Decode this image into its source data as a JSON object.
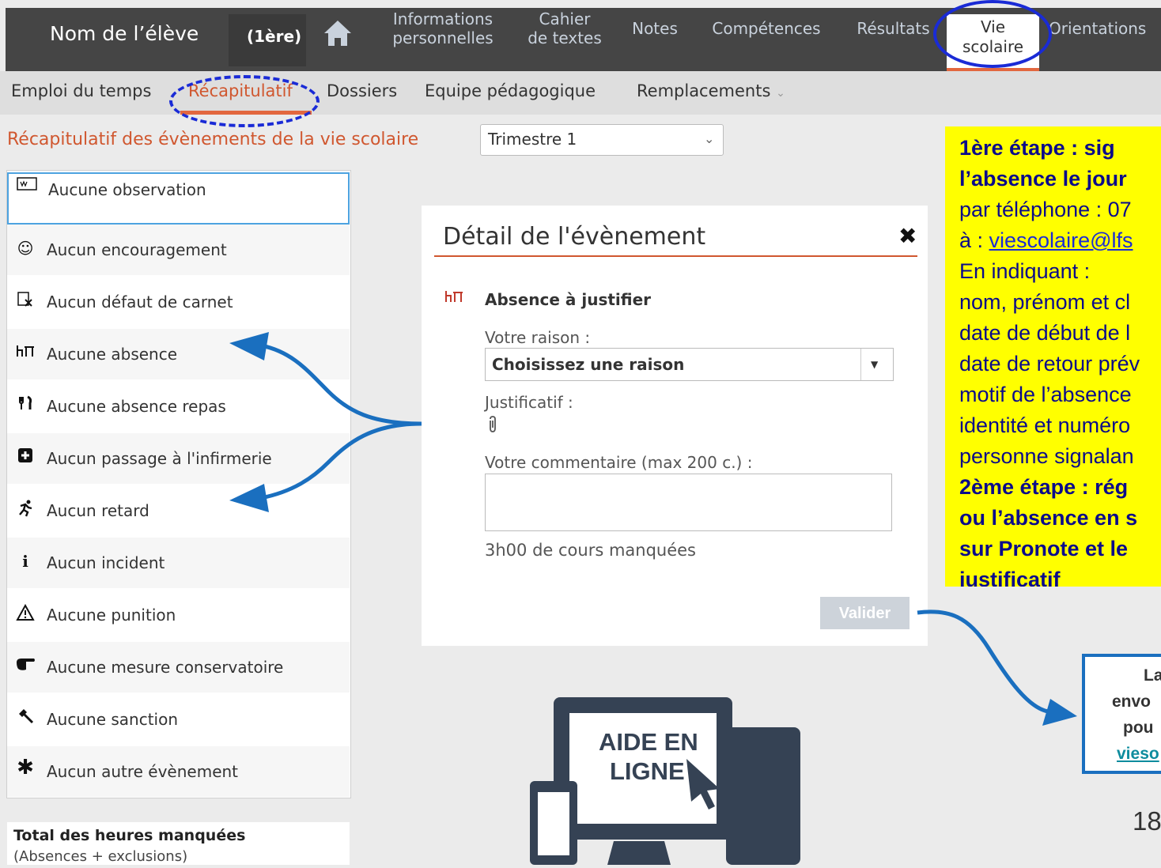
{
  "header": {
    "student_name": "Nom de l’élève",
    "class_label": "(1ère)",
    "tabs": [
      {
        "label_1": "Informations",
        "label_2": "personnelles"
      },
      {
        "label_1": "Cahier",
        "label_2": "de textes"
      },
      {
        "label": "Notes"
      },
      {
        "label": "Compétences"
      },
      {
        "label": "Résultats"
      },
      {
        "label_1": "Vie",
        "label_2": "scolaire",
        "active": true
      },
      {
        "label": "Orientations"
      }
    ]
  },
  "subnav": {
    "items": [
      "Emploi du temps",
      "Récapitulatif",
      "Dossiers",
      "Equipe pédagogique",
      "Remplacements"
    ]
  },
  "page": {
    "title": "Récapitulatif des évènements de la vie scolaire",
    "period": "Trimestre 1"
  },
  "events": [
    {
      "icon": "observation-icon",
      "label": "Aucune observation"
    },
    {
      "icon": "smiley-icon",
      "label": "Aucun encouragement"
    },
    {
      "icon": "notebook-defect-icon",
      "label": "Aucun défaut de carnet"
    },
    {
      "icon": "desk-icon",
      "label": "Aucune absence"
    },
    {
      "icon": "cutlery-icon",
      "label": "Aucune absence repas"
    },
    {
      "icon": "medical-cross-icon",
      "label": "Aucun passage à l'infirmerie"
    },
    {
      "icon": "running-icon",
      "label": "Aucun retard"
    },
    {
      "icon": "info-icon",
      "label": "Aucun incident"
    },
    {
      "icon": "warning-icon",
      "label": "Aucune punition"
    },
    {
      "icon": "pointing-hand-icon",
      "label": "Aucune mesure conservatoire"
    },
    {
      "icon": "gavel-icon",
      "label": "Aucune sanction"
    },
    {
      "icon": "asterisk-icon",
      "label": "Aucun autre évènement"
    }
  ],
  "totals": {
    "label": "Total des heures manquées",
    "sub": "(Absences + exclusions)"
  },
  "modal": {
    "title": "Détail de l'évènement",
    "type": "Absence à justifier",
    "reason_label": "Votre raison :",
    "reason_placeholder": "Choisissez une raison",
    "proof_label": "Justificatif :",
    "comment_label": "Votre commentaire (max 200 c.) :",
    "hours_missed": "3h00 de cours manquées",
    "validate": "Valider"
  },
  "note": {
    "step1_a": "1ère étape : sig",
    "step1_b": "l’absence le jour",
    "phone": "par téléphone : 07",
    "email_prefix": "à : ",
    "email": "viescolaire@lfs",
    "indicating": "En indiquant :",
    "l1": "nom, prénom et cl",
    "l2": "date de début de l",
    "l3": "date de retour prév",
    "l4": "motif de l’absence",
    "l5": "identité et numéro",
    "l6": "personne signalan",
    "step2_a": "2ème étape : rég",
    "step2_b": "ou l’absence en s",
    "step2_c": "sur Pronote et le",
    "step2_d": "justificatif"
  },
  "info_box": {
    "l1": "La",
    "l2": "envo",
    "l3": "pou",
    "l4": "vieso"
  },
  "help": {
    "line1": "AIDE EN",
    "line2": "LIGNE"
  },
  "page_number": "18"
}
